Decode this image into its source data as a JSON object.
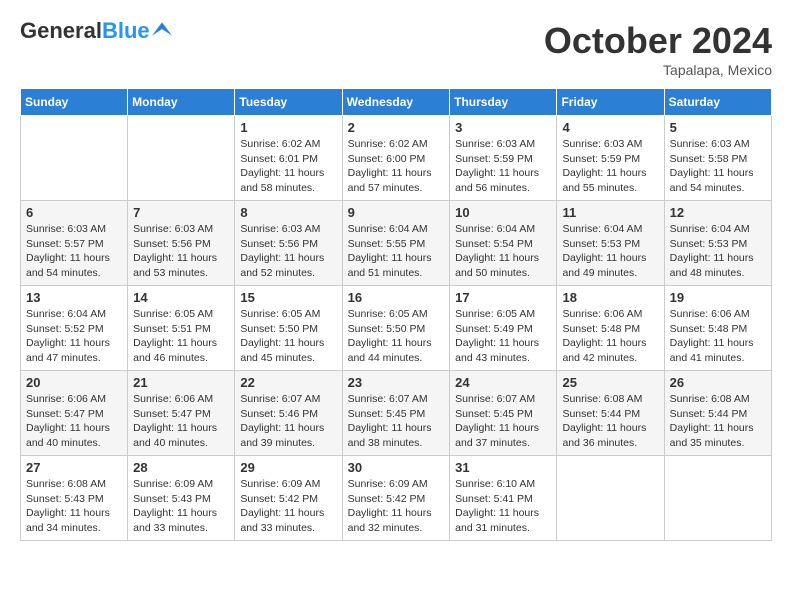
{
  "header": {
    "logo_general": "General",
    "logo_blue": "Blue",
    "month": "October 2024",
    "location": "Tapalapa, Mexico"
  },
  "weekdays": [
    "Sunday",
    "Monday",
    "Tuesday",
    "Wednesday",
    "Thursday",
    "Friday",
    "Saturday"
  ],
  "weeks": [
    [
      {
        "day": "",
        "info": ""
      },
      {
        "day": "",
        "info": ""
      },
      {
        "day": "1",
        "info": "Sunrise: 6:02 AM\nSunset: 6:01 PM\nDaylight: 11 hours and 58 minutes."
      },
      {
        "day": "2",
        "info": "Sunrise: 6:02 AM\nSunset: 6:00 PM\nDaylight: 11 hours and 57 minutes."
      },
      {
        "day": "3",
        "info": "Sunrise: 6:03 AM\nSunset: 5:59 PM\nDaylight: 11 hours and 56 minutes."
      },
      {
        "day": "4",
        "info": "Sunrise: 6:03 AM\nSunset: 5:59 PM\nDaylight: 11 hours and 55 minutes."
      },
      {
        "day": "5",
        "info": "Sunrise: 6:03 AM\nSunset: 5:58 PM\nDaylight: 11 hours and 54 minutes."
      }
    ],
    [
      {
        "day": "6",
        "info": "Sunrise: 6:03 AM\nSunset: 5:57 PM\nDaylight: 11 hours and 54 minutes."
      },
      {
        "day": "7",
        "info": "Sunrise: 6:03 AM\nSunset: 5:56 PM\nDaylight: 11 hours and 53 minutes."
      },
      {
        "day": "8",
        "info": "Sunrise: 6:03 AM\nSunset: 5:56 PM\nDaylight: 11 hours and 52 minutes."
      },
      {
        "day": "9",
        "info": "Sunrise: 6:04 AM\nSunset: 5:55 PM\nDaylight: 11 hours and 51 minutes."
      },
      {
        "day": "10",
        "info": "Sunrise: 6:04 AM\nSunset: 5:54 PM\nDaylight: 11 hours and 50 minutes."
      },
      {
        "day": "11",
        "info": "Sunrise: 6:04 AM\nSunset: 5:53 PM\nDaylight: 11 hours and 49 minutes."
      },
      {
        "day": "12",
        "info": "Sunrise: 6:04 AM\nSunset: 5:53 PM\nDaylight: 11 hours and 48 minutes."
      }
    ],
    [
      {
        "day": "13",
        "info": "Sunrise: 6:04 AM\nSunset: 5:52 PM\nDaylight: 11 hours and 47 minutes."
      },
      {
        "day": "14",
        "info": "Sunrise: 6:05 AM\nSunset: 5:51 PM\nDaylight: 11 hours and 46 minutes."
      },
      {
        "day": "15",
        "info": "Sunrise: 6:05 AM\nSunset: 5:50 PM\nDaylight: 11 hours and 45 minutes."
      },
      {
        "day": "16",
        "info": "Sunrise: 6:05 AM\nSunset: 5:50 PM\nDaylight: 11 hours and 44 minutes."
      },
      {
        "day": "17",
        "info": "Sunrise: 6:05 AM\nSunset: 5:49 PM\nDaylight: 11 hours and 43 minutes."
      },
      {
        "day": "18",
        "info": "Sunrise: 6:06 AM\nSunset: 5:48 PM\nDaylight: 11 hours and 42 minutes."
      },
      {
        "day": "19",
        "info": "Sunrise: 6:06 AM\nSunset: 5:48 PM\nDaylight: 11 hours and 41 minutes."
      }
    ],
    [
      {
        "day": "20",
        "info": "Sunrise: 6:06 AM\nSunset: 5:47 PM\nDaylight: 11 hours and 40 minutes."
      },
      {
        "day": "21",
        "info": "Sunrise: 6:06 AM\nSunset: 5:47 PM\nDaylight: 11 hours and 40 minutes."
      },
      {
        "day": "22",
        "info": "Sunrise: 6:07 AM\nSunset: 5:46 PM\nDaylight: 11 hours and 39 minutes."
      },
      {
        "day": "23",
        "info": "Sunrise: 6:07 AM\nSunset: 5:45 PM\nDaylight: 11 hours and 38 minutes."
      },
      {
        "day": "24",
        "info": "Sunrise: 6:07 AM\nSunset: 5:45 PM\nDaylight: 11 hours and 37 minutes."
      },
      {
        "day": "25",
        "info": "Sunrise: 6:08 AM\nSunset: 5:44 PM\nDaylight: 11 hours and 36 minutes."
      },
      {
        "day": "26",
        "info": "Sunrise: 6:08 AM\nSunset: 5:44 PM\nDaylight: 11 hours and 35 minutes."
      }
    ],
    [
      {
        "day": "27",
        "info": "Sunrise: 6:08 AM\nSunset: 5:43 PM\nDaylight: 11 hours and 34 minutes."
      },
      {
        "day": "28",
        "info": "Sunrise: 6:09 AM\nSunset: 5:43 PM\nDaylight: 11 hours and 33 minutes."
      },
      {
        "day": "29",
        "info": "Sunrise: 6:09 AM\nSunset: 5:42 PM\nDaylight: 11 hours and 33 minutes."
      },
      {
        "day": "30",
        "info": "Sunrise: 6:09 AM\nSunset: 5:42 PM\nDaylight: 11 hours and 32 minutes."
      },
      {
        "day": "31",
        "info": "Sunrise: 6:10 AM\nSunset: 5:41 PM\nDaylight: 11 hours and 31 minutes."
      },
      {
        "day": "",
        "info": ""
      },
      {
        "day": "",
        "info": ""
      }
    ]
  ]
}
